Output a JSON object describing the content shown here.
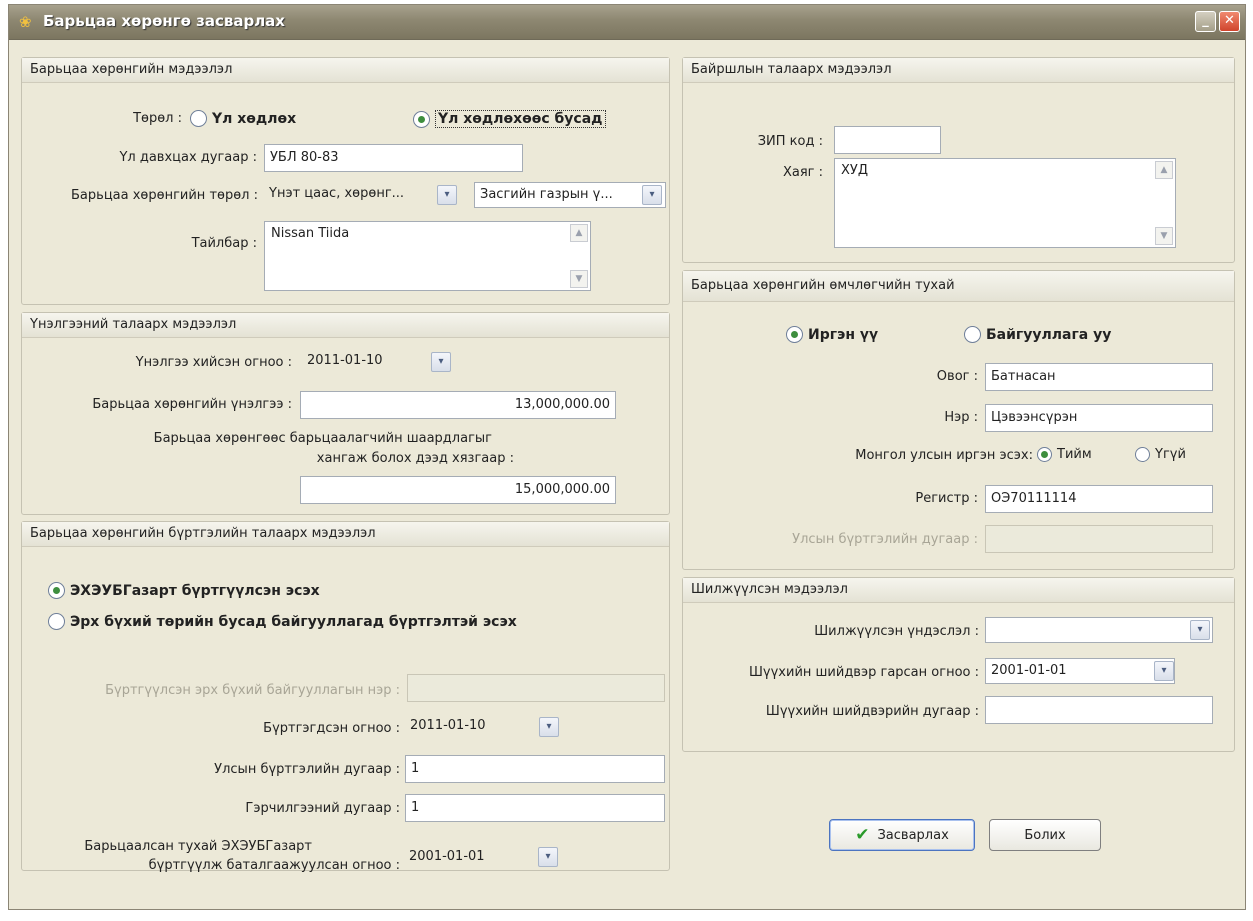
{
  "window": {
    "title": "Барьцаа хөрөнгө засварлах"
  },
  "collateral_info": {
    "header": "Барьцаа хөрөнгийн мэдээлэл",
    "type_label": "Төрөл :",
    "type_options": [
      "Үл хөдлөх",
      "Үл хөдлөхөөс бусад"
    ],
    "selected_type": 1,
    "plate_label": "Үл давхцах дугаар :",
    "plate_value": "УБЛ 80-83",
    "asset_type_label": "Барьцаа хөрөнгийн төрөл :",
    "asset_type_value1": "Үнэт цаас, хөрөнг...",
    "asset_type_value2": "Засгийн газрын ү...",
    "desc_label": "Тайлбар :",
    "desc_value": "Nissan Tiida"
  },
  "valuation": {
    "header": "Үнэлгээний талаарх мэдээлэл",
    "date_label": "Үнэлгээ хийсэн огноо :",
    "date_value": "2011-01-10",
    "value_label": "Барьцаа хөрөнгийн үнэлгээ :",
    "value_value": "13,000,000.00",
    "limit_label_1": "Барьцаа хөрөнгөөс барьцаалагчийн шаардлагыг",
    "limit_label_2": "хангаж болох дээд хязгаар :",
    "limit_value": "15,000,000.00"
  },
  "registration": {
    "header": "Барьцаа хөрөнгийн бүртгэлийн талаарх мэдээлэл",
    "options": [
      "ЭХЭУБГазарт бүртгүүлсэн эсэх",
      "Эрх бүхий төрийн бусад байгууллагад бүртгэлтэй эсэх"
    ],
    "selected": 0,
    "org_label": "Бүртгүүлсэн эрх бүхий байгууллагын нэр :",
    "reg_date_label": "Бүртгэгдсэн огноо :",
    "reg_date_value": "2011-01-10",
    "state_no_label": "Улсын бүртгэлийн дугаар :",
    "state_no_value": "1",
    "cert_no_label": "Гэрчилгээний дугаар :",
    "cert_no_value": "1",
    "confirm_label_1": "Барьцаалсан тухай ЭХЭУБГазарт",
    "confirm_label_2": "бүртгүүлж  баталгаажуулсан огноо :",
    "confirm_value": "2001-01-01"
  },
  "location": {
    "header": "Байршлын талаарх мэдээлэл",
    "zip_label": "ЗИП код :",
    "zip_value": "",
    "addr_label": "Хаяг :",
    "addr_value": "ХУД"
  },
  "owner": {
    "header": "Барьцаа хөрөнгийн өмчлөгчийн тухай",
    "options": [
      "Иргэн үү",
      "Байгууллага уу"
    ],
    "selected": 0,
    "surname_label": "Овог :",
    "surname_value": "Батнасан",
    "name_label": "Нэр :",
    "name_value": "Цэвээнсүрэн",
    "citizen_label": "Монгол улсын иргэн эсэх:",
    "citizen_options": [
      "Тийм",
      "Үгүй"
    ],
    "citizen_selected": 0,
    "register_label": "Регистр :",
    "register_value": "ОЭ70111114",
    "state_no_label": "Улсын бүртгэлийн дугаар :"
  },
  "transfer": {
    "header": "Шилжүүлсэн мэдээлэл",
    "reason_label": "Шилжүүлсэн үндэслэл :",
    "reason_value": "",
    "court_date_label": "Шүүхийн шийдвэр гарсан огноо :",
    "court_date_value": "2001-01-01",
    "court_no_label": "Шүүхийн шийдвэрийн дугаар :",
    "court_no_value": ""
  },
  "buttons": {
    "save": "Засварлах",
    "cancel": "Болих"
  }
}
